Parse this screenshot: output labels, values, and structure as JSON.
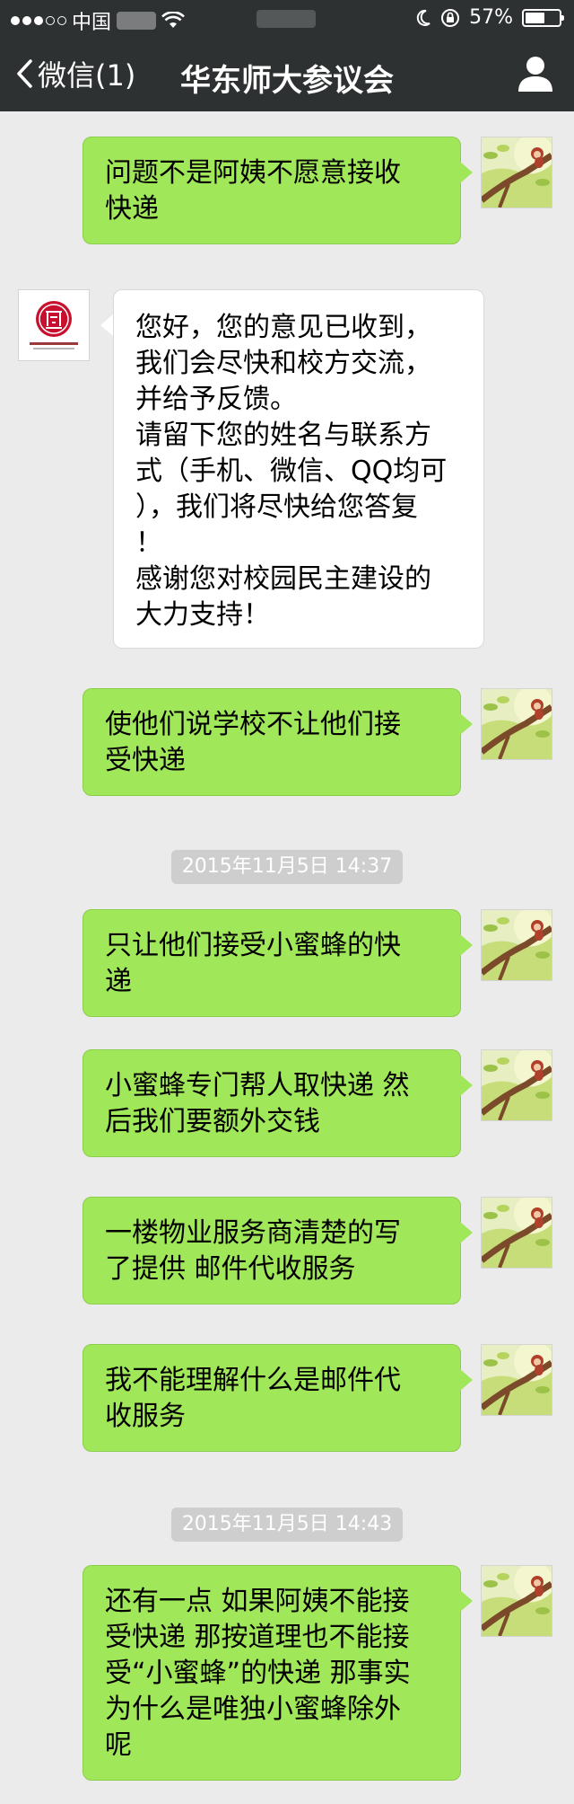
{
  "status_bar": {
    "carrier": "中国",
    "battery_percent": "57%",
    "battery_level": 0.57
  },
  "nav": {
    "back_label": "微信(1)",
    "title": "华东师大参议会"
  },
  "colors": {
    "nav_bg": "#2e3132",
    "chat_bg": "#ebebeb",
    "outgoing_bubble": "#a0e75a",
    "incoming_bubble": "#ffffff",
    "timestamp_bg": "#cecece"
  },
  "messages": [
    {
      "direction": "out",
      "lines": [
        "问题不是阿姨不愿意接收",
        "快递"
      ]
    },
    {
      "direction": "in",
      "lines": [
        "您好，您的意见已收到，",
        "我们会尽快和校方交流，",
        "并给予反馈。",
        "请留下您的姓名与联系方",
        "式（手机、微信、QQ均可",
        "），我们将尽快给您答复",
        "！",
        "感谢您对校园民主建设的",
        "大力支持！"
      ]
    },
    {
      "direction": "out",
      "lines": [
        "使他们说学校不让他们接",
        "受快递"
      ]
    },
    {
      "direction": "time",
      "text": "2015年11月5日 14:37"
    },
    {
      "direction": "out",
      "lines": [
        "只让他们接受小蜜蜂的快",
        "递"
      ]
    },
    {
      "direction": "out",
      "lines": [
        "小蜜蜂专门帮人取快递 然",
        "后我们要额外交钱"
      ]
    },
    {
      "direction": "out",
      "lines": [
        "一楼物业服务商清楚的写",
        "了提供 邮件代收服务"
      ]
    },
    {
      "direction": "out",
      "lines": [
        "我不能理解什么是邮件代",
        "收服务"
      ]
    },
    {
      "direction": "time",
      "text": "2015年11月5日 14:43"
    },
    {
      "direction": "out",
      "lines": [
        "还有一点 如果阿姨不能接",
        "受快递 那按道理也不能接",
        "受“小蜜蜂”的快递 那事实",
        "为什么是唯独小蜜蜂除外",
        "呢"
      ]
    }
  ],
  "icons": {
    "back": "chevron-left-icon",
    "profile": "person-icon",
    "wifi": "wifi-icon",
    "moon": "moon-icon",
    "rotation_lock": "rotation-lock-icon",
    "battery": "battery-icon"
  }
}
